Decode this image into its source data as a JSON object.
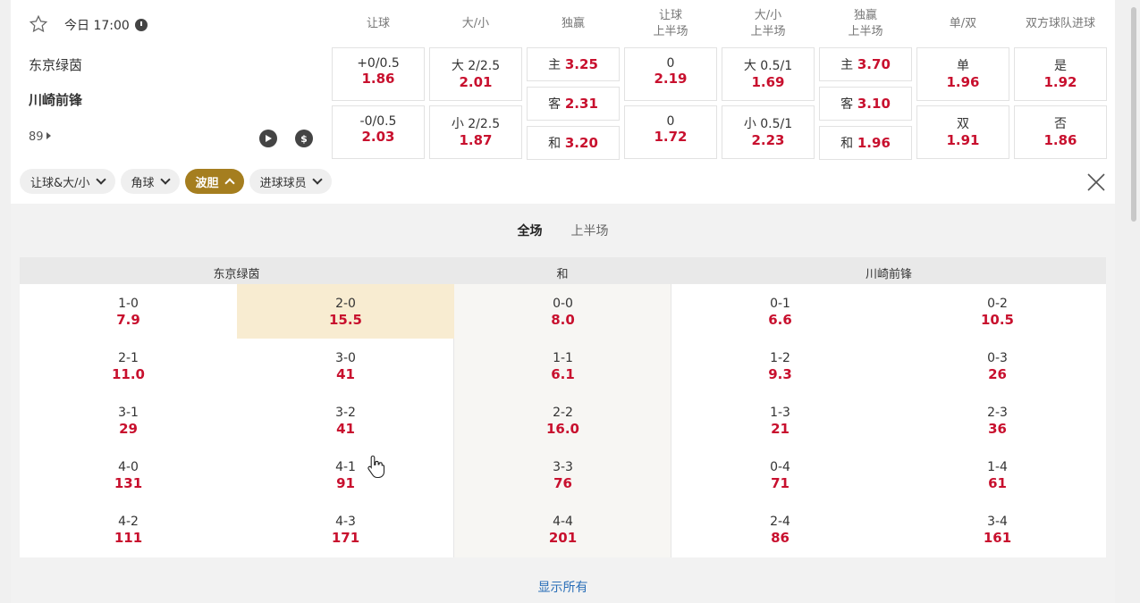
{
  "match": {
    "time": "今日 17:00",
    "home_team": "东京绿茵",
    "away_team": "川崎前锋",
    "minute": "89"
  },
  "columns": [
    "让球",
    "大/小",
    "独赢",
    "让球\n上半场",
    "大/小\n上半场",
    "独赢\n上半场",
    "单/双",
    "双方球队进球"
  ],
  "markets": {
    "handicap": [
      {
        "label": "+0/0.5",
        "odds": "1.86"
      },
      {
        "label": "-0/0.5",
        "odds": "2.03"
      }
    ],
    "over_under": [
      {
        "label": "大 2/2.5",
        "odds": "2.01"
      },
      {
        "label": "小 2/2.5",
        "odds": "1.87"
      }
    ],
    "moneyline": [
      {
        "label": "主",
        "odds": "3.25"
      },
      {
        "label": "客",
        "odds": "2.31"
      },
      {
        "label": "和",
        "odds": "3.20"
      }
    ],
    "handicap_1h": [
      {
        "label": "0",
        "odds": "2.19"
      },
      {
        "label": "0",
        "odds": "1.72"
      }
    ],
    "over_under_1h": [
      {
        "label": "大 0.5/1",
        "odds": "1.69"
      },
      {
        "label": "小 0.5/1",
        "odds": "2.23"
      }
    ],
    "moneyline_1h": [
      {
        "label": "主",
        "odds": "3.70"
      },
      {
        "label": "客",
        "odds": "3.10"
      },
      {
        "label": "和",
        "odds": "1.96"
      }
    ],
    "odd_even": [
      {
        "label": "单",
        "odds": "1.96"
      },
      {
        "label": "双",
        "odds": "1.91"
      }
    ],
    "btts": [
      {
        "label": "是",
        "odds": "1.92"
      },
      {
        "label": "否",
        "odds": "1.86"
      }
    ]
  },
  "chips": [
    {
      "label": "让球&大/小",
      "active": false
    },
    {
      "label": "角球",
      "active": false
    },
    {
      "label": "波胆",
      "active": true
    },
    {
      "label": "进球球员",
      "active": false
    }
  ],
  "subtabs": [
    {
      "label": "全场",
      "active": true
    },
    {
      "label": "上半场",
      "active": false
    }
  ],
  "correct_score": {
    "headers": {
      "home": "东京绿茵",
      "draw": "和",
      "away": "川崎前锋"
    },
    "home": [
      [
        {
          "score": "1-0",
          "odds": "7.9"
        },
        {
          "score": "2-0",
          "odds": "15.5",
          "selected": true
        }
      ],
      [
        {
          "score": "2-1",
          "odds": "11.0"
        },
        {
          "score": "3-0",
          "odds": "41"
        }
      ],
      [
        {
          "score": "3-1",
          "odds": "29"
        },
        {
          "score": "3-2",
          "odds": "41"
        }
      ],
      [
        {
          "score": "4-0",
          "odds": "131"
        },
        {
          "score": "4-1",
          "odds": "91"
        }
      ],
      [
        {
          "score": "4-2",
          "odds": "111"
        },
        {
          "score": "4-3",
          "odds": "171"
        }
      ]
    ],
    "draw": [
      {
        "score": "0-0",
        "odds": "8.0"
      },
      {
        "score": "1-1",
        "odds": "6.1"
      },
      {
        "score": "2-2",
        "odds": "16.0"
      },
      {
        "score": "3-3",
        "odds": "76"
      },
      {
        "score": "4-4",
        "odds": "201"
      }
    ],
    "away": [
      [
        {
          "score": "0-1",
          "odds": "6.6"
        },
        {
          "score": "0-2",
          "odds": "10.5"
        }
      ],
      [
        {
          "score": "1-2",
          "odds": "9.3"
        },
        {
          "score": "0-3",
          "odds": "26"
        }
      ],
      [
        {
          "score": "1-3",
          "odds": "21"
        },
        {
          "score": "2-3",
          "odds": "36"
        }
      ],
      [
        {
          "score": "0-4",
          "odds": "71"
        },
        {
          "score": "1-4",
          "odds": "61"
        }
      ],
      [
        {
          "score": "2-4",
          "odds": "86"
        },
        {
          "score": "3-4",
          "odds": "161"
        }
      ]
    ]
  },
  "show_all_label": "显示所有",
  "colors": {
    "odds_red": "#c8102e",
    "active_chip": "#a57e1f",
    "highlight": "#f8ecd1",
    "link_blue": "#2a6fb8"
  }
}
